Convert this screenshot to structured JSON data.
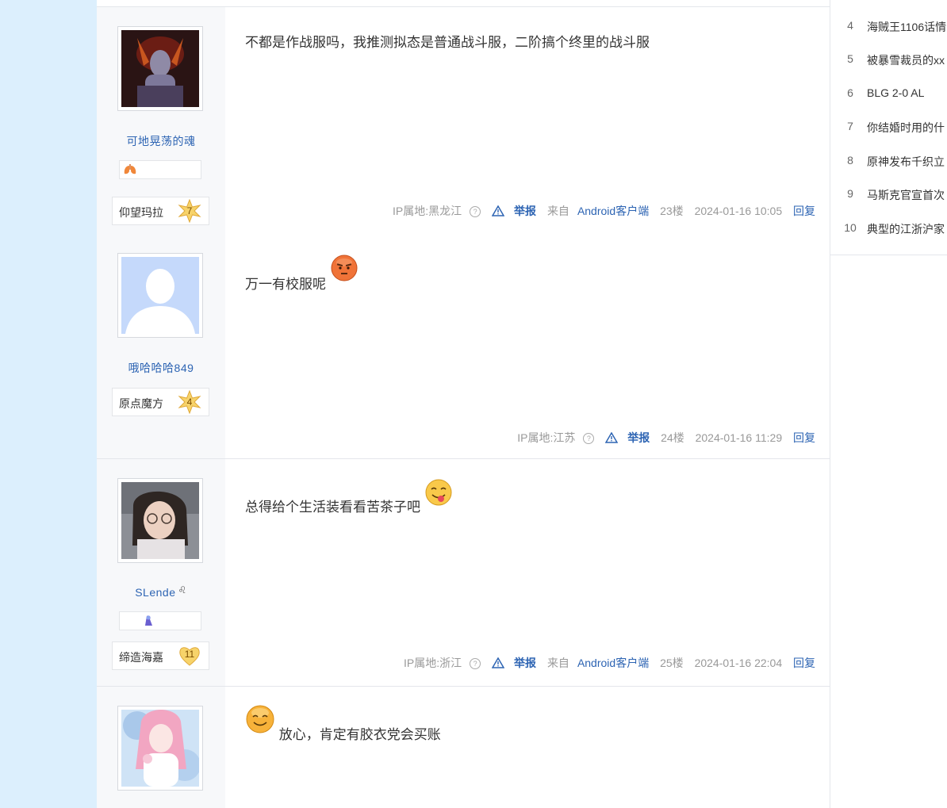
{
  "hot_list": [
    {
      "rank": "4",
      "title": "海贼王1106话情"
    },
    {
      "rank": "5",
      "title": "被暴雪裁员的xx"
    },
    {
      "rank": "6",
      "title": "BLG 2-0 AL"
    },
    {
      "rank": "7",
      "title": "你结婚时用的什"
    },
    {
      "rank": "8",
      "title": "原神发布千织立"
    },
    {
      "rank": "9",
      "title": "马斯克官宣首次"
    },
    {
      "rank": "10",
      "title": "典型的江浙沪家"
    }
  ],
  "posts": [
    {
      "username": "可地晃荡的魂",
      "username_symbol": "",
      "level_name": "仰望玛拉",
      "level": "7",
      "content": "不都是作战服吗，我推测拟态是普通战斗服，二阶搞个终里的战斗服",
      "ip": "IP属地:黑龙江",
      "report": "举报",
      "client": "来自Android客户端",
      "floor": "23楼",
      "time": "2024-01-16 10:05",
      "reply": "回复"
    },
    {
      "username": "哦哈哈哈849",
      "username_symbol": "",
      "level_name": "原点魔方",
      "level": "4",
      "content": "万一有校服呢",
      "ip": "IP属地:江苏",
      "report": "举报",
      "client": "",
      "floor": "24楼",
      "time": "2024-01-16 11:29",
      "reply": "回复"
    },
    {
      "username": "SLende",
      "username_symbol": "♌",
      "level_name": "缔造海嘉",
      "level": "11",
      "content": "总得给个生活装看看苦茶子吧",
      "ip": "IP属地:浙江",
      "report": "举报",
      "client": "来自Android客户端",
      "floor": "25楼",
      "time": "2024-01-16 22:04",
      "reply": "回复"
    },
    {
      "username": "",
      "content": "放心，肯定有胶衣党会买账"
    }
  ],
  "colors": {
    "link": "#2d64b3",
    "page_bg": "#dceffd",
    "author_bg": "#f7f8fa"
  }
}
